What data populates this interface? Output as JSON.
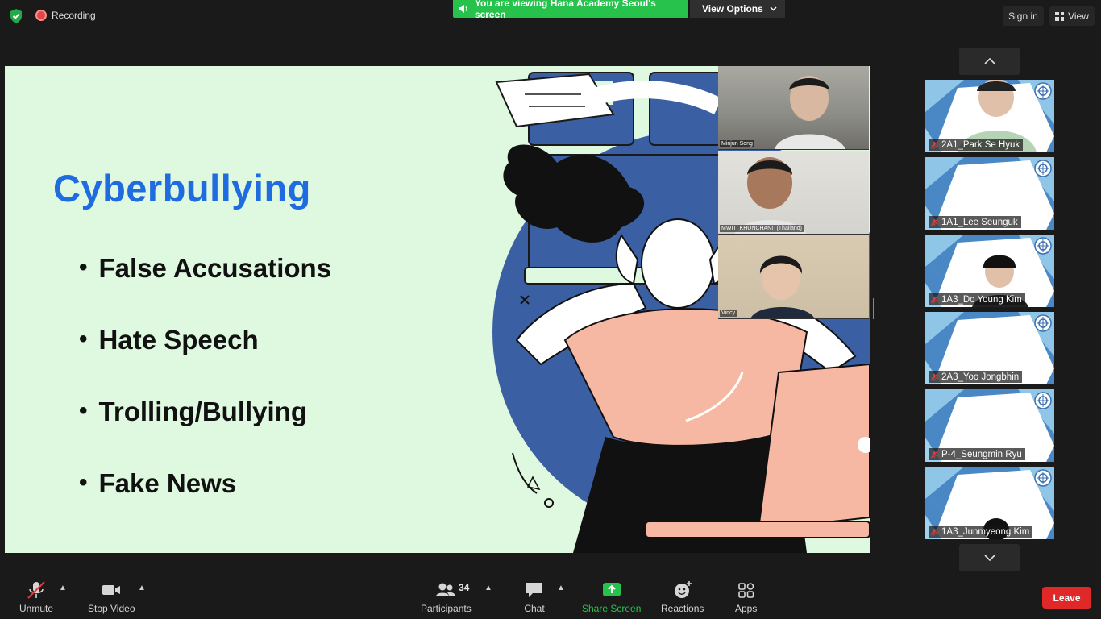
{
  "topbar": {
    "recording_label": "Recording",
    "viewing_banner": "You are viewing Hana Academy Seoul's screen",
    "view_options_label": "View Options",
    "sign_in_label": "Sign in",
    "view_label": "View"
  },
  "slide": {
    "title": "Cyberbullying",
    "bullets": [
      "False Accusations",
      "Hate Speech",
      "Trolling/Bullying",
      "Fake News"
    ]
  },
  "video_tiles": [
    {
      "name": "Minjun Song"
    },
    {
      "name": "MWIT_KHUNCHANIT(Thailand)"
    },
    {
      "name": "Vincy"
    }
  ],
  "participants_strip": [
    {
      "name": "2A1_Park Se Hyuk"
    },
    {
      "name": "1A1_Lee Seunguk"
    },
    {
      "name": "1A3_Do Young Kim"
    },
    {
      "name": "2A3_Yoo Jongbhin"
    },
    {
      "name": "P-4_Seungmin Ryu"
    },
    {
      "name": "1A3_Junmyeong Kim"
    }
  ],
  "toolbar": {
    "unmute_label": "Unmute",
    "stop_video_label": "Stop Video",
    "participants_label": "Participants",
    "participants_count": "34",
    "chat_label": "Chat",
    "share_screen_label": "Share Screen",
    "reactions_label": "Reactions",
    "apps_label": "Apps",
    "leave_label": "Leave"
  },
  "colors": {
    "accent_green": "#27c24c",
    "leave_red": "#e02828",
    "slide_bg": "#dff8e0",
    "title_blue": "#1f6be0"
  },
  "icons": [
    "shield-icon",
    "recording-icon",
    "speaker-icon",
    "chevron-down-icon",
    "grid-view-icon",
    "chevron-up-icon",
    "mic-muted-icon",
    "camera-icon",
    "participants-icon",
    "chat-icon",
    "share-screen-icon",
    "reactions-icon",
    "apps-icon",
    "school-logo-icon"
  ]
}
